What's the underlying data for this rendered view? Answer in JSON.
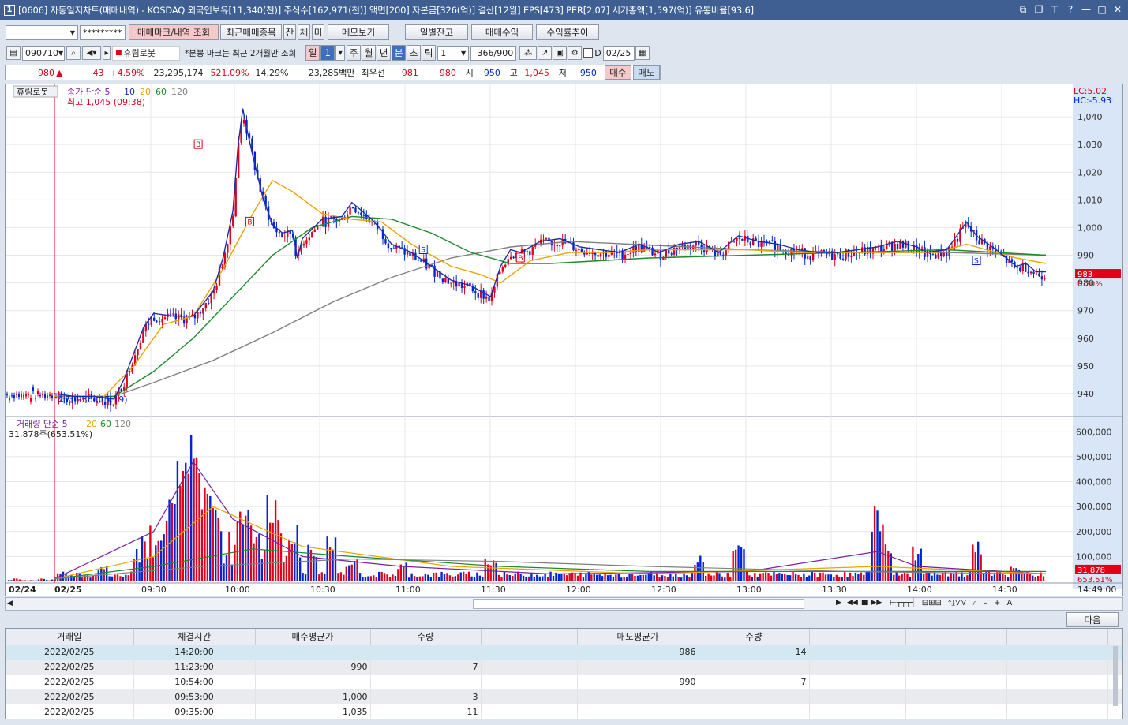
{
  "window": {
    "badge": "1",
    "title": "[0606] 자동일지차트(매매내역) - KOSDAQ 외국인보유[11,340(천)] 주식수[162,971(천)] 액면[200] 자본금[326(억)] 결산[12월] EPS[473] PER[2.07] 시가총액[1,597(억)] 유통비율[93.6]"
  },
  "toolbar1": {
    "account_input": "",
    "password_mask": "*********",
    "buttons": [
      "매매마크/내역 조회",
      "최근매매종목",
      "잔",
      "체",
      "미",
      "메모보기",
      "일별잔고",
      "매매수익",
      "수익률추이"
    ]
  },
  "toolbar2": {
    "code": "090710",
    "stock_name": "휴림로봇",
    "notice": "*분봉 마크는 최근 2개월만 조회",
    "period_buttons": [
      "일",
      "1",
      "주",
      "월",
      "년",
      "분",
      "초",
      "틱"
    ],
    "interval": "1",
    "count": "366/900",
    "d_label": "D",
    "date": "02/25"
  },
  "quote": {
    "price": "980",
    "arrow": "▲",
    "change": "43",
    "change_pct": "+4.59%",
    "volume": "23,295,174",
    "vol_ratio": "521.09%",
    "turnover": "14.29%",
    "amount": "23,285백만",
    "best_label": "최우선",
    "ask": "981",
    "bid": "980",
    "open_label": "시",
    "open": "950",
    "high_label": "고",
    "high": "1,045",
    "low_label": "저",
    "low": "950",
    "buy_btn": "매수",
    "sell_btn": "매도"
  },
  "chart_data": [
    {
      "type": "line",
      "name_tag": "휴림로봇",
      "legend": [
        "종가 단순 5",
        "10",
        "20",
        "60",
        "120"
      ],
      "colors": {
        "ma5": "#1b2fa6",
        "ma10": "#1b2fa6",
        "ma20": "#e8a400",
        "ma60": "#1e8a2c",
        "ma120": "#808080",
        "up": "#e0001b",
        "down": "#0026d4"
      },
      "high_label": "최고 1,045 (09:38)",
      "low_label": "최저 936 (15:19)",
      "lc": "LC:5.02",
      "hc": "HC:-5.93",
      "current": "983",
      "current_pct": "0.20%",
      "y_ticks": [
        "1,040",
        "1,030",
        "1,020",
        "1,010",
        "1,000",
        "990",
        "980",
        "970",
        "960",
        "950",
        "940"
      ],
      "y_values": [
        1040,
        1030,
        1020,
        1010,
        1000,
        990,
        980,
        970,
        960,
        950,
        940
      ],
      "ylim": [
        932,
        1050
      ],
      "x_ticks": [
        "02/24",
        "02/25",
        "09:30",
        "10:00",
        "10:30",
        "11:00",
        "11:30",
        "12:00",
        "12:30",
        "13:00",
        "13:30",
        "14:00",
        "14:30",
        "14:49:00"
      ],
      "price_path": [
        [
          0,
          939
        ],
        [
          0.02,
          938
        ],
        [
          0.04,
          938
        ],
        [
          0.06,
          937
        ],
        [
          0.07,
          944
        ],
        [
          0.09,
          963
        ],
        [
          0.1,
          968
        ],
        [
          0.12,
          967
        ],
        [
          0.14,
          967
        ],
        [
          0.16,
          976
        ],
        [
          0.17,
          988
        ],
        [
          0.18,
          1005
        ],
        [
          0.185,
          1028
        ],
        [
          0.19,
          1042
        ],
        [
          0.195,
          1033
        ],
        [
          0.2,
          1025
        ],
        [
          0.21,
          1010
        ],
        [
          0.22,
          1000
        ],
        [
          0.23,
          997
        ],
        [
          0.24,
          998
        ],
        [
          0.245,
          988
        ],
        [
          0.25,
          995
        ],
        [
          0.27,
          1002
        ],
        [
          0.29,
          1003
        ],
        [
          0.3,
          1008
        ],
        [
          0.31,
          1005
        ],
        [
          0.32,
          1002
        ],
        [
          0.33,
          998
        ],
        [
          0.34,
          993
        ],
        [
          0.36,
          990
        ],
        [
          0.38,
          985
        ],
        [
          0.4,
          980
        ],
        [
          0.42,
          978
        ],
        [
          0.44,
          974
        ],
        [
          0.45,
          985
        ],
        [
          0.46,
          991
        ],
        [
          0.47,
          990
        ],
        [
          0.49,
          994
        ],
        [
          0.51,
          995
        ],
        [
          0.53,
          992
        ],
        [
          0.55,
          991
        ],
        [
          0.57,
          990
        ],
        [
          0.59,
          993
        ],
        [
          0.61,
          990
        ],
        [
          0.63,
          993
        ],
        [
          0.65,
          994
        ],
        [
          0.67,
          990
        ],
        [
          0.69,
          996
        ],
        [
          0.71,
          994
        ],
        [
          0.73,
          993
        ],
        [
          0.75,
          991
        ],
        [
          0.77,
          990
        ],
        [
          0.79,
          990
        ],
        [
          0.81,
          991
        ],
        [
          0.83,
          992
        ],
        [
          0.85,
          994
        ],
        [
          0.87,
          992
        ],
        [
          0.88,
          990
        ],
        [
          0.9,
          991
        ],
        [
          0.92,
          1001
        ],
        [
          0.93,
          996
        ],
        [
          0.95,
          991
        ],
        [
          0.97,
          985
        ],
        [
          0.98,
          986
        ],
        [
          0.99,
          983
        ],
        [
          1.0,
          983
        ]
      ],
      "ma20_path": [
        [
          0,
          939
        ],
        [
          0.05,
          939
        ],
        [
          0.08,
          950
        ],
        [
          0.11,
          965
        ],
        [
          0.14,
          968
        ],
        [
          0.17,
          985
        ],
        [
          0.2,
          1005
        ],
        [
          0.22,
          1017
        ],
        [
          0.24,
          1013
        ],
        [
          0.27,
          1005
        ],
        [
          0.3,
          1003
        ],
        [
          0.33,
          1002
        ],
        [
          0.36,
          994
        ],
        [
          0.4,
          986
        ],
        [
          0.43,
          983
        ],
        [
          0.45,
          980
        ],
        [
          0.48,
          988
        ],
        [
          0.52,
          991
        ],
        [
          0.56,
          991
        ],
        [
          0.6,
          992
        ],
        [
          0.65,
          992
        ],
        [
          0.7,
          992
        ],
        [
          0.75,
          991
        ],
        [
          0.8,
          991
        ],
        [
          0.85,
          991
        ],
        [
          0.89,
          991
        ],
        [
          0.92,
          994
        ],
        [
          0.94,
          992
        ],
        [
          0.97,
          989
        ],
        [
          1.0,
          987
        ]
      ],
      "ma60_path": [
        [
          0,
          939
        ],
        [
          0.06,
          939
        ],
        [
          0.1,
          948
        ],
        [
          0.14,
          960
        ],
        [
          0.18,
          975
        ],
        [
          0.22,
          990
        ],
        [
          0.26,
          1000
        ],
        [
          0.3,
          1004
        ],
        [
          0.34,
          1003
        ],
        [
          0.38,
          998
        ],
        [
          0.42,
          991
        ],
        [
          0.46,
          987
        ],
        [
          0.5,
          987
        ],
        [
          0.55,
          988
        ],
        [
          0.6,
          989
        ],
        [
          0.7,
          990
        ],
        [
          0.8,
          991
        ],
        [
          0.9,
          992
        ],
        [
          0.95,
          991
        ],
        [
          1.0,
          990
        ]
      ],
      "ma120_path": [
        [
          0,
          939
        ],
        [
          0.06,
          939
        ],
        [
          0.1,
          944
        ],
        [
          0.16,
          952
        ],
        [
          0.22,
          962
        ],
        [
          0.28,
          973
        ],
        [
          0.34,
          982
        ],
        [
          0.4,
          989
        ],
        [
          0.46,
          993
        ],
        [
          0.52,
          995
        ],
        [
          0.58,
          994
        ],
        [
          0.64,
          993
        ],
        [
          0.7,
          992
        ],
        [
          0.8,
          991
        ],
        [
          0.9,
          991
        ],
        [
          1.0,
          990
        ]
      ]
    },
    {
      "type": "bar",
      "legend": [
        "거래량 단순 5",
        "20",
        "60",
        "120"
      ],
      "volume_label": "31,878주(653.51%)",
      "current": "31,878",
      "current_pct": "653.51%",
      "y_ticks": [
        "600,000",
        "500,000",
        "400,000",
        "300,000",
        "200,000",
        "100,000"
      ],
      "y_values": [
        600000,
        500000,
        400000,
        300000,
        200000,
        100000
      ],
      "ylim": [
        0,
        620000
      ],
      "peaks": [
        [
          0.048,
          70000
        ],
        [
          0.11,
          250000
        ],
        [
          0.12,
          390000
        ],
        [
          0.13,
          580000
        ],
        [
          0.135,
          590000
        ],
        [
          0.14,
          560000
        ],
        [
          0.15,
          450000
        ],
        [
          0.16,
          370000
        ],
        [
          0.19,
          300000
        ],
        [
          0.22,
          380000
        ],
        [
          0.24,
          200000
        ],
        [
          0.26,
          160000
        ],
        [
          0.28,
          180000
        ],
        [
          0.3,
          90000
        ],
        [
          0.35,
          80000
        ],
        [
          0.44,
          100000
        ],
        [
          0.65,
          110000
        ],
        [
          0.69,
          160000
        ],
        [
          0.83,
          310000
        ],
        [
          0.84,
          180000
        ],
        [
          0.87,
          140000
        ],
        [
          0.93,
          160000
        ],
        [
          0.97,
          60000
        ]
      ]
    }
  ],
  "scroll": {
    "next_btn": "다음"
  },
  "table": {
    "headers": [
      "거래일",
      "체결시간",
      "매수평균가",
      "수량",
      "",
      "매도평균가",
      "수량",
      "",
      "",
      "",
      ""
    ],
    "rows": [
      [
        "2022/02/25",
        "14:20:00",
        "",
        "",
        "",
        "986",
        "14",
        "",
        "",
        "",
        ""
      ],
      [
        "2022/02/25",
        "11:23:00",
        "990",
        "7",
        "",
        "",
        "",
        "",
        "",
        "",
        ""
      ],
      [
        "2022/02/25",
        "10:54:00",
        "",
        "",
        "",
        "990",
        "7",
        "",
        "",
        "",
        ""
      ],
      [
        "2022/02/25",
        "09:53:00",
        "1,000",
        "3",
        "",
        "",
        "",
        "",
        "",
        "",
        ""
      ],
      [
        "2022/02/25",
        "09:35:00",
        "1,035",
        "11",
        "",
        "",
        "",
        "",
        "",
        "",
        ""
      ]
    ]
  }
}
